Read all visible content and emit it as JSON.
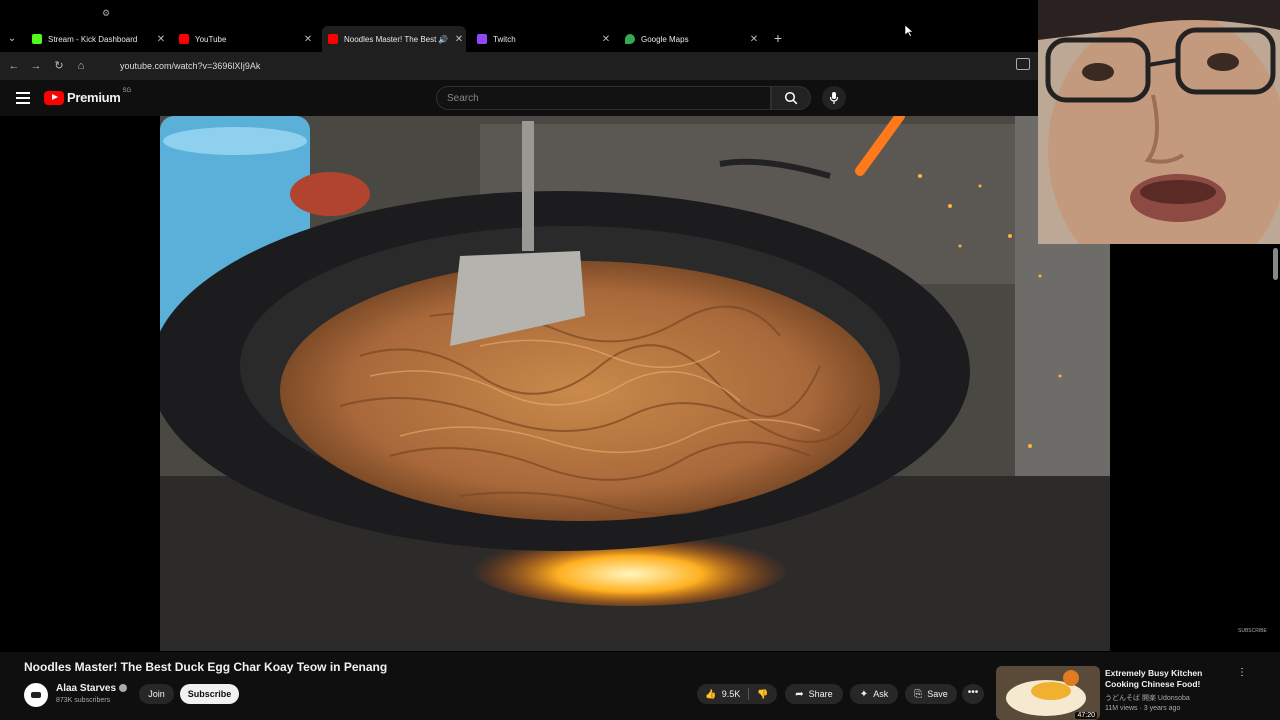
{
  "browser": {
    "tabs": [
      {
        "label": "Stream - Kick Dashboard",
        "favicon_color": "#53fc18",
        "icon": "kick-favicon"
      },
      {
        "label": "YouTube",
        "favicon_color": "#ff0000",
        "icon": "youtube-favicon"
      },
      {
        "label": "Noodles Master! The Best",
        "favicon_color": "#ff0000",
        "icon": "youtube-favicon",
        "active": true,
        "audio": true
      },
      {
        "label": "Twitch",
        "favicon_color": "#9146ff",
        "icon": "twitch-favicon"
      },
      {
        "label": "Google Maps",
        "favicon_color": "#34a853",
        "icon": "maps-favicon"
      }
    ],
    "url": "youtube.com/watch?v=3696lXIj9Ak"
  },
  "youtube": {
    "brand": "Premium",
    "region": "SG",
    "search_placeholder": "Search"
  },
  "video": {
    "title": "Noodles Master! The Best Duck Egg Char Koay Teow in Penang",
    "channel": "Alaa Starves",
    "subscribers": "873K subscribers",
    "join_label": "Join",
    "subscribe_label": "Subscribe",
    "likes": "9.5K",
    "share_label": "Share",
    "ask_label": "Ask",
    "save_label": "Save",
    "watermark": "SUBSCRIBE"
  },
  "suggestion": {
    "title": "Extremely Busy Kitchen Cooking Chinese Food! Vetera...",
    "channel": "うどんそば 開楽 Udonsoba",
    "meta": "11M views · 3 years ago",
    "duration": "47:20"
  },
  "colors": {
    "accent": "#ff0000",
    "background": "#0f0f0f"
  }
}
